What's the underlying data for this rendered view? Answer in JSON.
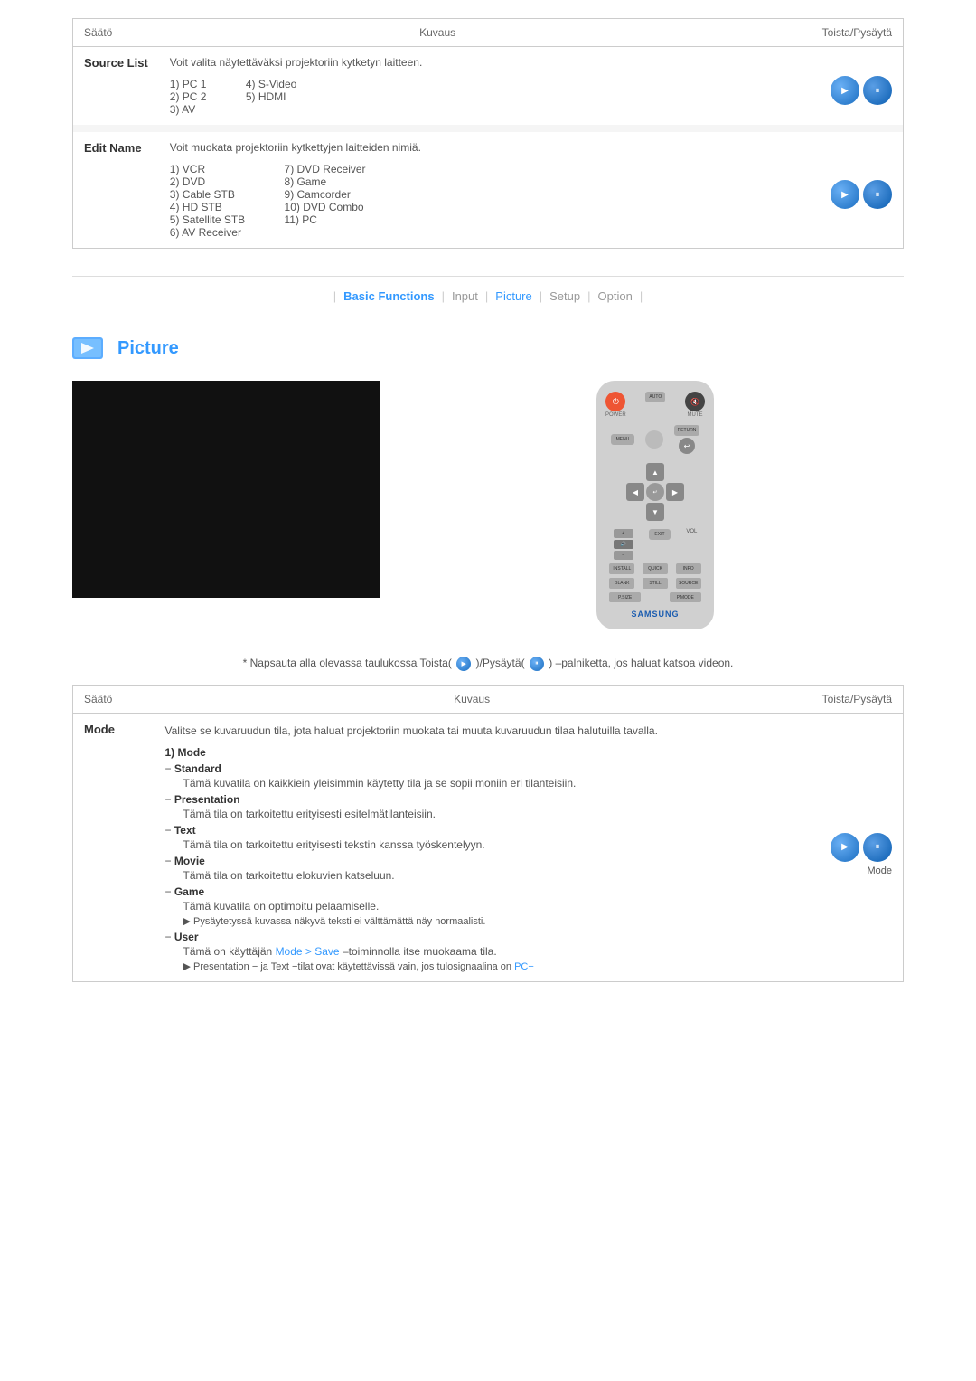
{
  "top_table": {
    "headers": {
      "col1": "Säätö",
      "col2": "Kuvaus",
      "col3": "Toista/Pysäytä"
    },
    "rows": [
      {
        "label": "Source List",
        "description": "Voit valita näytettäväksi projektoriin kytketyn laitteen.",
        "items_left": [
          "1) PC 1",
          "2) PC 2",
          "3) AV"
        ],
        "items_right": [
          "4) S-Video",
          "5) HDMI"
        ],
        "has_buttons": true
      },
      {
        "label": "Edit Name",
        "description": "Voit muokata projektoriin kytkettyjen laitteiden nimiä.",
        "items_left": [
          "1) VCR",
          "2) DVD",
          "3) Cable STB",
          "4) HD STB",
          "5) Satellite STB",
          "6) AV Receiver"
        ],
        "items_right": [
          "7) DVD Receiver",
          "8) Game",
          "9) Camcorder",
          "10) DVD Combo",
          "11) PC"
        ],
        "has_buttons": true
      }
    ]
  },
  "nav": {
    "separator": "|",
    "items": [
      {
        "label": "Basic Functions",
        "active": true
      },
      {
        "label": "Input",
        "active": false
      },
      {
        "label": "Picture",
        "active": true,
        "highlight": true
      },
      {
        "label": "Setup",
        "active": false
      },
      {
        "label": "Option",
        "active": false
      }
    ]
  },
  "picture_section": {
    "title": "Picture",
    "note": "* Napsauta alla olevassa taulukossa Toista(",
    "note_middle": ")/Pysäytä(",
    "note_end": ") –palniketta, jos haluat katsoa videon."
  },
  "bottom_table": {
    "headers": {
      "col1": "Säätö",
      "col2": "Kuvaus",
      "col3": "Toista/Pysäytä"
    },
    "mode_row": {
      "label": "Mode",
      "description": "Valitse se kuvaruudun tila, jota haluat projektoriin muokata tai muuta kuvaruudun tilaa halutuilla tavalla.",
      "sub_label": "1) Mode",
      "items": [
        {
          "name": "Standard",
          "desc": "Tämä kuvatila on kaikkiein yleisimmin käytetty tila ja se sopii moniin eri tilanteisiin.",
          "is_dash": true
        },
        {
          "name": "Presentation",
          "desc": "Tämä tila on tarkoitettu erityisesti esitelmätilanteisiin.",
          "is_dash": true
        },
        {
          "name": "Text",
          "desc": "Tämä tila on tarkoitettu erityisesti tekstin kanssa työskentelyyn.",
          "is_dash": true
        },
        {
          "name": "Movie",
          "desc": "Tämä tila on tarkoitettu elokuvien katseluun.",
          "is_dash": true
        },
        {
          "name": "Game",
          "desc": "Tämä kuvatila on optimoitu pelaamiselle.",
          "note": "▶ Pysäytetyssä kuvassa näkyvä teksti ei välttämättä näy normaalisti.",
          "is_dash": true
        },
        {
          "name": "User",
          "desc_parts": [
            "Tämä on käyttäjän ",
            "Mode > Save",
            " –toiminnolla itse muokaama tila."
          ],
          "note": "▶ Presentation − ja Text −tilat ovat käytettävissä vain, jos tulosignaalina on PC−",
          "is_dash": true,
          "has_link": true
        }
      ],
      "play_label": "Mode"
    }
  },
  "remote": {
    "brand": "SAMSUNG",
    "buttons": {
      "power": "⏻",
      "auto": "AUTO",
      "mute": "🔇",
      "menu": "MENU",
      "return": "RETURN",
      "up": "▲",
      "down": "▼",
      "left": "◀",
      "right": "▶",
      "enter": "↵",
      "exit": "EXIT",
      "vol_plus": "+",
      "vol_minus": "−",
      "vol_label": "VOL",
      "install": "INSTALL",
      "quick": "QUICK",
      "info": "INFO",
      "blank": "BLANK",
      "still": "STILL",
      "source": "SOURCE",
      "psize": "P.SIZE",
      "pmode": "P.MODE"
    }
  }
}
